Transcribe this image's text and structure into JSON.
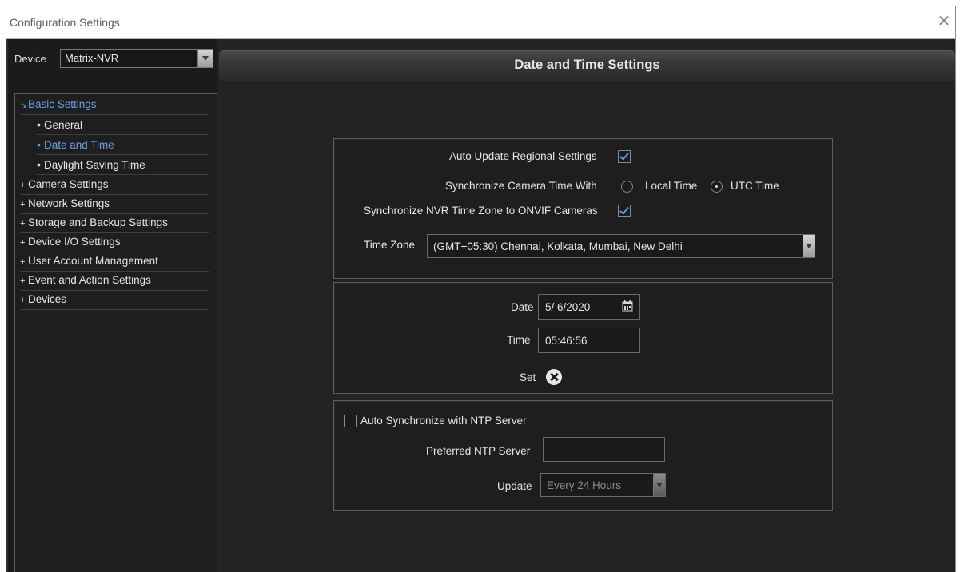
{
  "window": {
    "title": "Configuration Settings",
    "close_glyph": "✕"
  },
  "sidebar": {
    "device_label": "Device",
    "device_value": "Matrix-NVR",
    "tree": [
      {
        "label": "Basic Settings",
        "marker": "↘",
        "active": true
      },
      {
        "label": "General",
        "marker": "•",
        "active": false
      },
      {
        "label": "Date and Time",
        "marker": "•",
        "active": true
      },
      {
        "label": "Daylight Saving Time",
        "marker": "•",
        "active": false
      },
      {
        "label": "Camera Settings",
        "marker": "+",
        "active": false
      },
      {
        "label": "Network Settings",
        "marker": "+",
        "active": false
      },
      {
        "label": "Storage and Backup Settings",
        "marker": "+",
        "active": false
      },
      {
        "label": "Device I/O Settings",
        "marker": "+",
        "active": false
      },
      {
        "label": "User Account Management",
        "marker": "+",
        "active": false
      },
      {
        "label": "Event and Action Settings",
        "marker": "+",
        "active": false
      },
      {
        "label": "Devices",
        "marker": "+",
        "active": false
      }
    ]
  },
  "main": {
    "title": "Date and Time Settings",
    "regional": {
      "auto_update_label": "Auto Update Regional Settings",
      "auto_update_checked": true,
      "sync_camera_label": "Synchronize Camera Time With",
      "local_time_label": "Local Time",
      "utc_time_label": "UTC Time",
      "selected_sync": "UTC Time",
      "sync_nvr_tz_label": "Synchronize NVR Time Zone to ONVIF Cameras",
      "sync_nvr_tz_checked": true,
      "time_zone_label": "Time Zone",
      "time_zone_value": "(GMT+05:30) Chennai, Kolkata, Mumbai, New Delhi"
    },
    "datetime": {
      "date_label": "Date",
      "date_value": "5/ 6/2020",
      "time_label": "Time",
      "time_value": "05:46:56",
      "set_label": "Set"
    },
    "ntp": {
      "auto_sync_label": "Auto Synchronize with NTP Server",
      "auto_sync_checked": false,
      "preferred_server_label": "Preferred NTP Server",
      "preferred_server_value": "",
      "update_label": "Update",
      "update_value": "Every 24 Hours"
    }
  },
  "colors": {
    "accent": "#6aa4e6",
    "background": "#232323",
    "panel": "#1e1e1e",
    "text": "#e6e6e6"
  }
}
